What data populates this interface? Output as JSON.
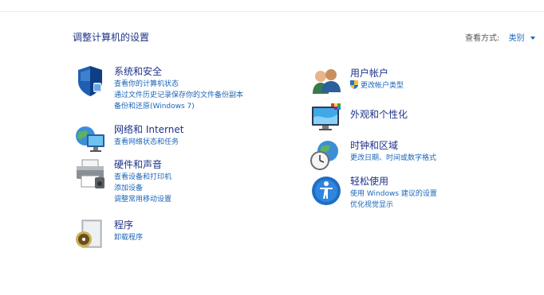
{
  "header": {
    "title": "调整计算机的设置",
    "view_by_label": "查看方式:",
    "view_by_value": "类别"
  },
  "left": [
    {
      "title": "系统和安全",
      "links": [
        "查看你的计算机状态",
        "通过文件历史记录保存你的文件备份副本",
        "备份和还原(Windows 7)"
      ]
    },
    {
      "title": "网络和 Internet",
      "links": [
        "查看网络状态和任务"
      ]
    },
    {
      "title": "硬件和声音",
      "links": [
        "查看设备和打印机",
        "添加设备",
        "调整常用移动设置"
      ]
    },
    {
      "title": "程序",
      "links": [
        "卸载程序"
      ]
    }
  ],
  "right": [
    {
      "title": "用户帐户",
      "links": [
        "更改帐户类型"
      ]
    },
    {
      "title": "外观和个性化",
      "links": []
    },
    {
      "title": "时钟和区域",
      "links": [
        "更改日期、时间或数字格式"
      ]
    },
    {
      "title": "轻松使用",
      "links": [
        "使用 Windows 建议的设置",
        "优化视觉显示"
      ]
    }
  ],
  "icons": {
    "system_security": "shield-icon",
    "network": "network-globe-icon",
    "hardware": "printer-icon",
    "programs": "program-disc-icon",
    "user_accounts": "users-icon",
    "appearance": "monitor-palette-icon",
    "clock_region": "clock-globe-icon",
    "ease_of_access": "ease-of-access-icon"
  }
}
